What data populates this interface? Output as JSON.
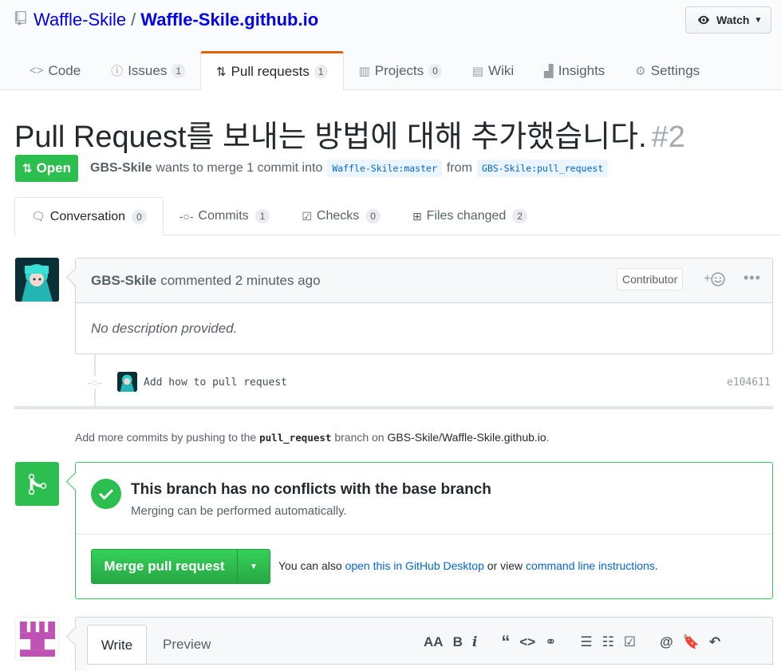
{
  "repo": {
    "owner": "Waffle-Skile",
    "separator": "/",
    "name": "Waffle-Skile.github.io",
    "watch_label": "Watch"
  },
  "nav": {
    "code": "Code",
    "issues": "Issues",
    "issues_count": "1",
    "pulls": "Pull requests",
    "pulls_count": "1",
    "projects": "Projects",
    "projects_count": "0",
    "wiki": "Wiki",
    "insights": "Insights",
    "settings": "Settings"
  },
  "pr": {
    "title": "Pull Request를 보내는 방법에 대해 추가했습니다.",
    "number": "#2",
    "state": "Open",
    "author": "GBS-Skile",
    "meta_text": "wants to merge 1 commit into",
    "base_branch": "Waffle-Skile:master",
    "from_text": "from",
    "head_branch": "GBS-Skile:pull_request"
  },
  "tabs": {
    "conversation": "Conversation",
    "conversation_count": "0",
    "commits": "Commits",
    "commits_count": "1",
    "checks": "Checks",
    "checks_count": "0",
    "files": "Files changed",
    "files_count": "2"
  },
  "comment": {
    "author": "GBS-Skile",
    "action": "commented 2 minutes ago",
    "label": "Contributor",
    "reaction": "+",
    "body": "No description provided."
  },
  "commit": {
    "message": "Add how to pull request",
    "sha": "e104611"
  },
  "push_note": {
    "prefix": "Add more commits by pushing to the",
    "branch": "pull_request",
    "middle": "branch on",
    "repo": "GBS-Skile/Waffle-Skile.github.io",
    "suffix": "."
  },
  "merge": {
    "heading": "This branch has no conflicts with the base branch",
    "sub": "Merging can be performed automatically.",
    "button": "Merge pull request",
    "alt_prefix": "You can also",
    "alt_link1": "open this in GitHub Desktop",
    "alt_middle": "or view",
    "alt_link2": "command line instructions",
    "alt_suffix": "."
  },
  "new_comment": {
    "write_tab": "Write",
    "preview_tab": "Preview",
    "toolbar": [
      "AA",
      "B",
      "i",
      "66",
      "<>",
      "link",
      "ul",
      "ol",
      "tasks",
      "@",
      "bookmark",
      "reply"
    ]
  },
  "colors": {
    "link": "#0366d6",
    "open_green": "#2cbe4e",
    "nav_accent": "#e36209"
  }
}
